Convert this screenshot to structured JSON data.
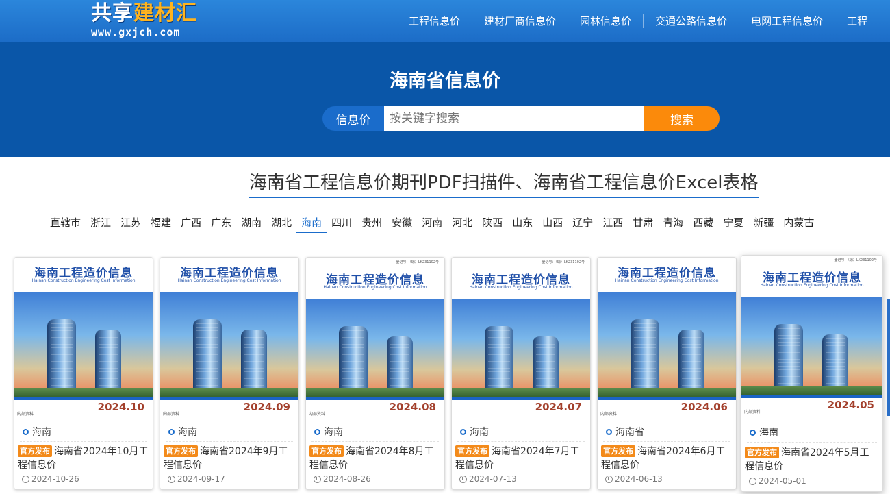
{
  "site": {
    "logo_part1": "共享",
    "logo_part2": "建材汇",
    "logo_url": "www.gxjch.com"
  },
  "nav": [
    "工程信息价",
    "建材厂商信息价",
    "园林信息价",
    "交通公路信息价",
    "电网工程信息价",
    "工程"
  ],
  "hero": {
    "title": "海南省信息价",
    "search_type": "信息价",
    "search_placeholder": "按关键字搜索",
    "search_button": "搜索"
  },
  "section_title": "海南省工程信息价期刊PDF扫描件、海南省工程信息价Excel表格",
  "provinces": [
    "直辖市",
    "浙江",
    "江苏",
    "福建",
    "广西",
    "广东",
    "湖南",
    "湖北",
    "海南",
    "四川",
    "贵州",
    "安徽",
    "河南",
    "河北",
    "陕西",
    "山东",
    "山西",
    "辽宁",
    "江西",
    "甘肃",
    "青海",
    "西藏",
    "宁夏",
    "新疆",
    "内蒙古"
  ],
  "active_province": "海南",
  "cards": [
    {
      "cover_title": "海南工程造价信息",
      "cover_subtitle": "Hainan Construction Engineering Cost Information",
      "cover_year": "2024.10",
      "cover_code": "",
      "cover_note": "内部资料",
      "region": "海南",
      "badge": "官方发布",
      "title": "海南省2024年10月工程信息价",
      "date": "2024-10-26"
    },
    {
      "cover_title": "海南工程造价信息",
      "cover_subtitle": "Hainan Construction Engineering Cost Information",
      "cover_year": "2024.09",
      "cover_code": "",
      "cover_note": "内部资料",
      "region": "海南",
      "badge": "官方发布",
      "title": "海南省2024年9月工程信息价",
      "date": "2024-09-17"
    },
    {
      "cover_title": "海南工程造价信息",
      "cover_subtitle": "Hainan Construction Engineering Cost Information",
      "cover_year": "2024.08",
      "cover_code": "登记号：（琼）LK231102号",
      "cover_note": "内部资料",
      "region": "海南",
      "badge": "官方发布",
      "title": "海南省2024年8月工程信息价",
      "date": "2024-08-26"
    },
    {
      "cover_title": "海南工程造价信息",
      "cover_subtitle": "Hainan Construction Engineering Cost Information",
      "cover_year": "2024.07",
      "cover_code": "登记号：（琼）LK231102号",
      "cover_note": "",
      "region": "海南",
      "badge": "官方发布",
      "title": "海南省2024年7月工程信息价",
      "date": "2024-07-13"
    },
    {
      "cover_title": "海南工程造价信息",
      "cover_subtitle": "Hainan Construction Engineering Cost Information",
      "cover_year": "2024.06",
      "cover_code": "",
      "cover_note": "内部资料",
      "region": "海南省",
      "badge": "官方发布",
      "title": "海南省2024年6月工程信息价",
      "date": "2024-06-13"
    },
    {
      "cover_title": "海南工程造价信息",
      "cover_subtitle": "Hainan Construction Engineering Cost Information",
      "cover_year": "2024.05",
      "cover_code": "登记号：（琼）LK231102号",
      "cover_note": "内部资料",
      "region": "海南",
      "badge": "官方发布",
      "title": "海南省2024年5月工程信息价",
      "date": "2024-05-01"
    }
  ]
}
